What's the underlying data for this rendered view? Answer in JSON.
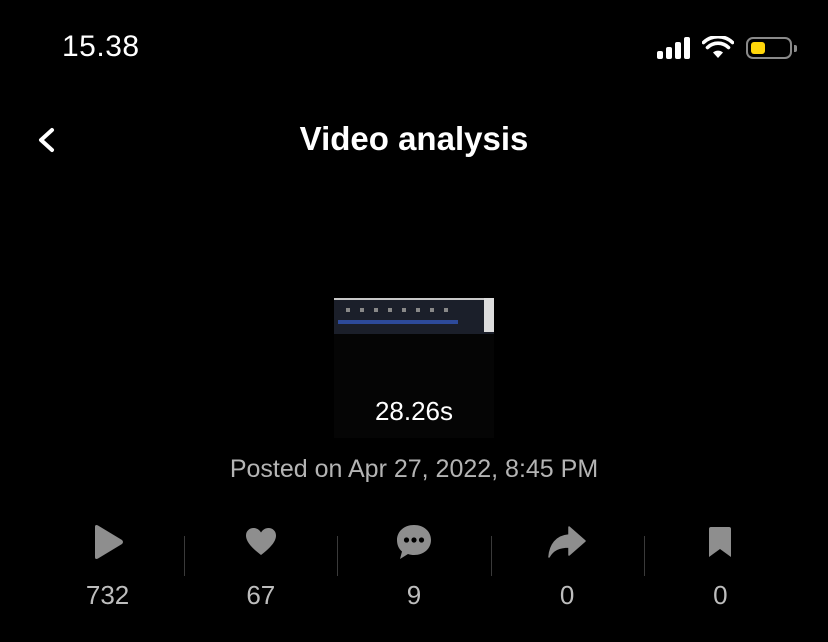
{
  "status_bar": {
    "time": "15.38",
    "battery_color": "#ffd60a"
  },
  "nav": {
    "title": "Video analysis",
    "back_icon": "chevron-left-icon"
  },
  "video": {
    "duration": "28.26s",
    "posted": "Posted on Apr 27, 2022, 8:45 PM"
  },
  "stats": [
    {
      "icon": "play-icon",
      "count": "732"
    },
    {
      "icon": "heart-icon",
      "count": "67"
    },
    {
      "icon": "comment-icon",
      "count": "9"
    },
    {
      "icon": "share-icon",
      "count": "0"
    },
    {
      "icon": "bookmark-icon",
      "count": "0"
    }
  ],
  "colors": {
    "background": "#000000",
    "icon_gray": "#8e8e8e",
    "count_gray": "#bdbdbd"
  }
}
